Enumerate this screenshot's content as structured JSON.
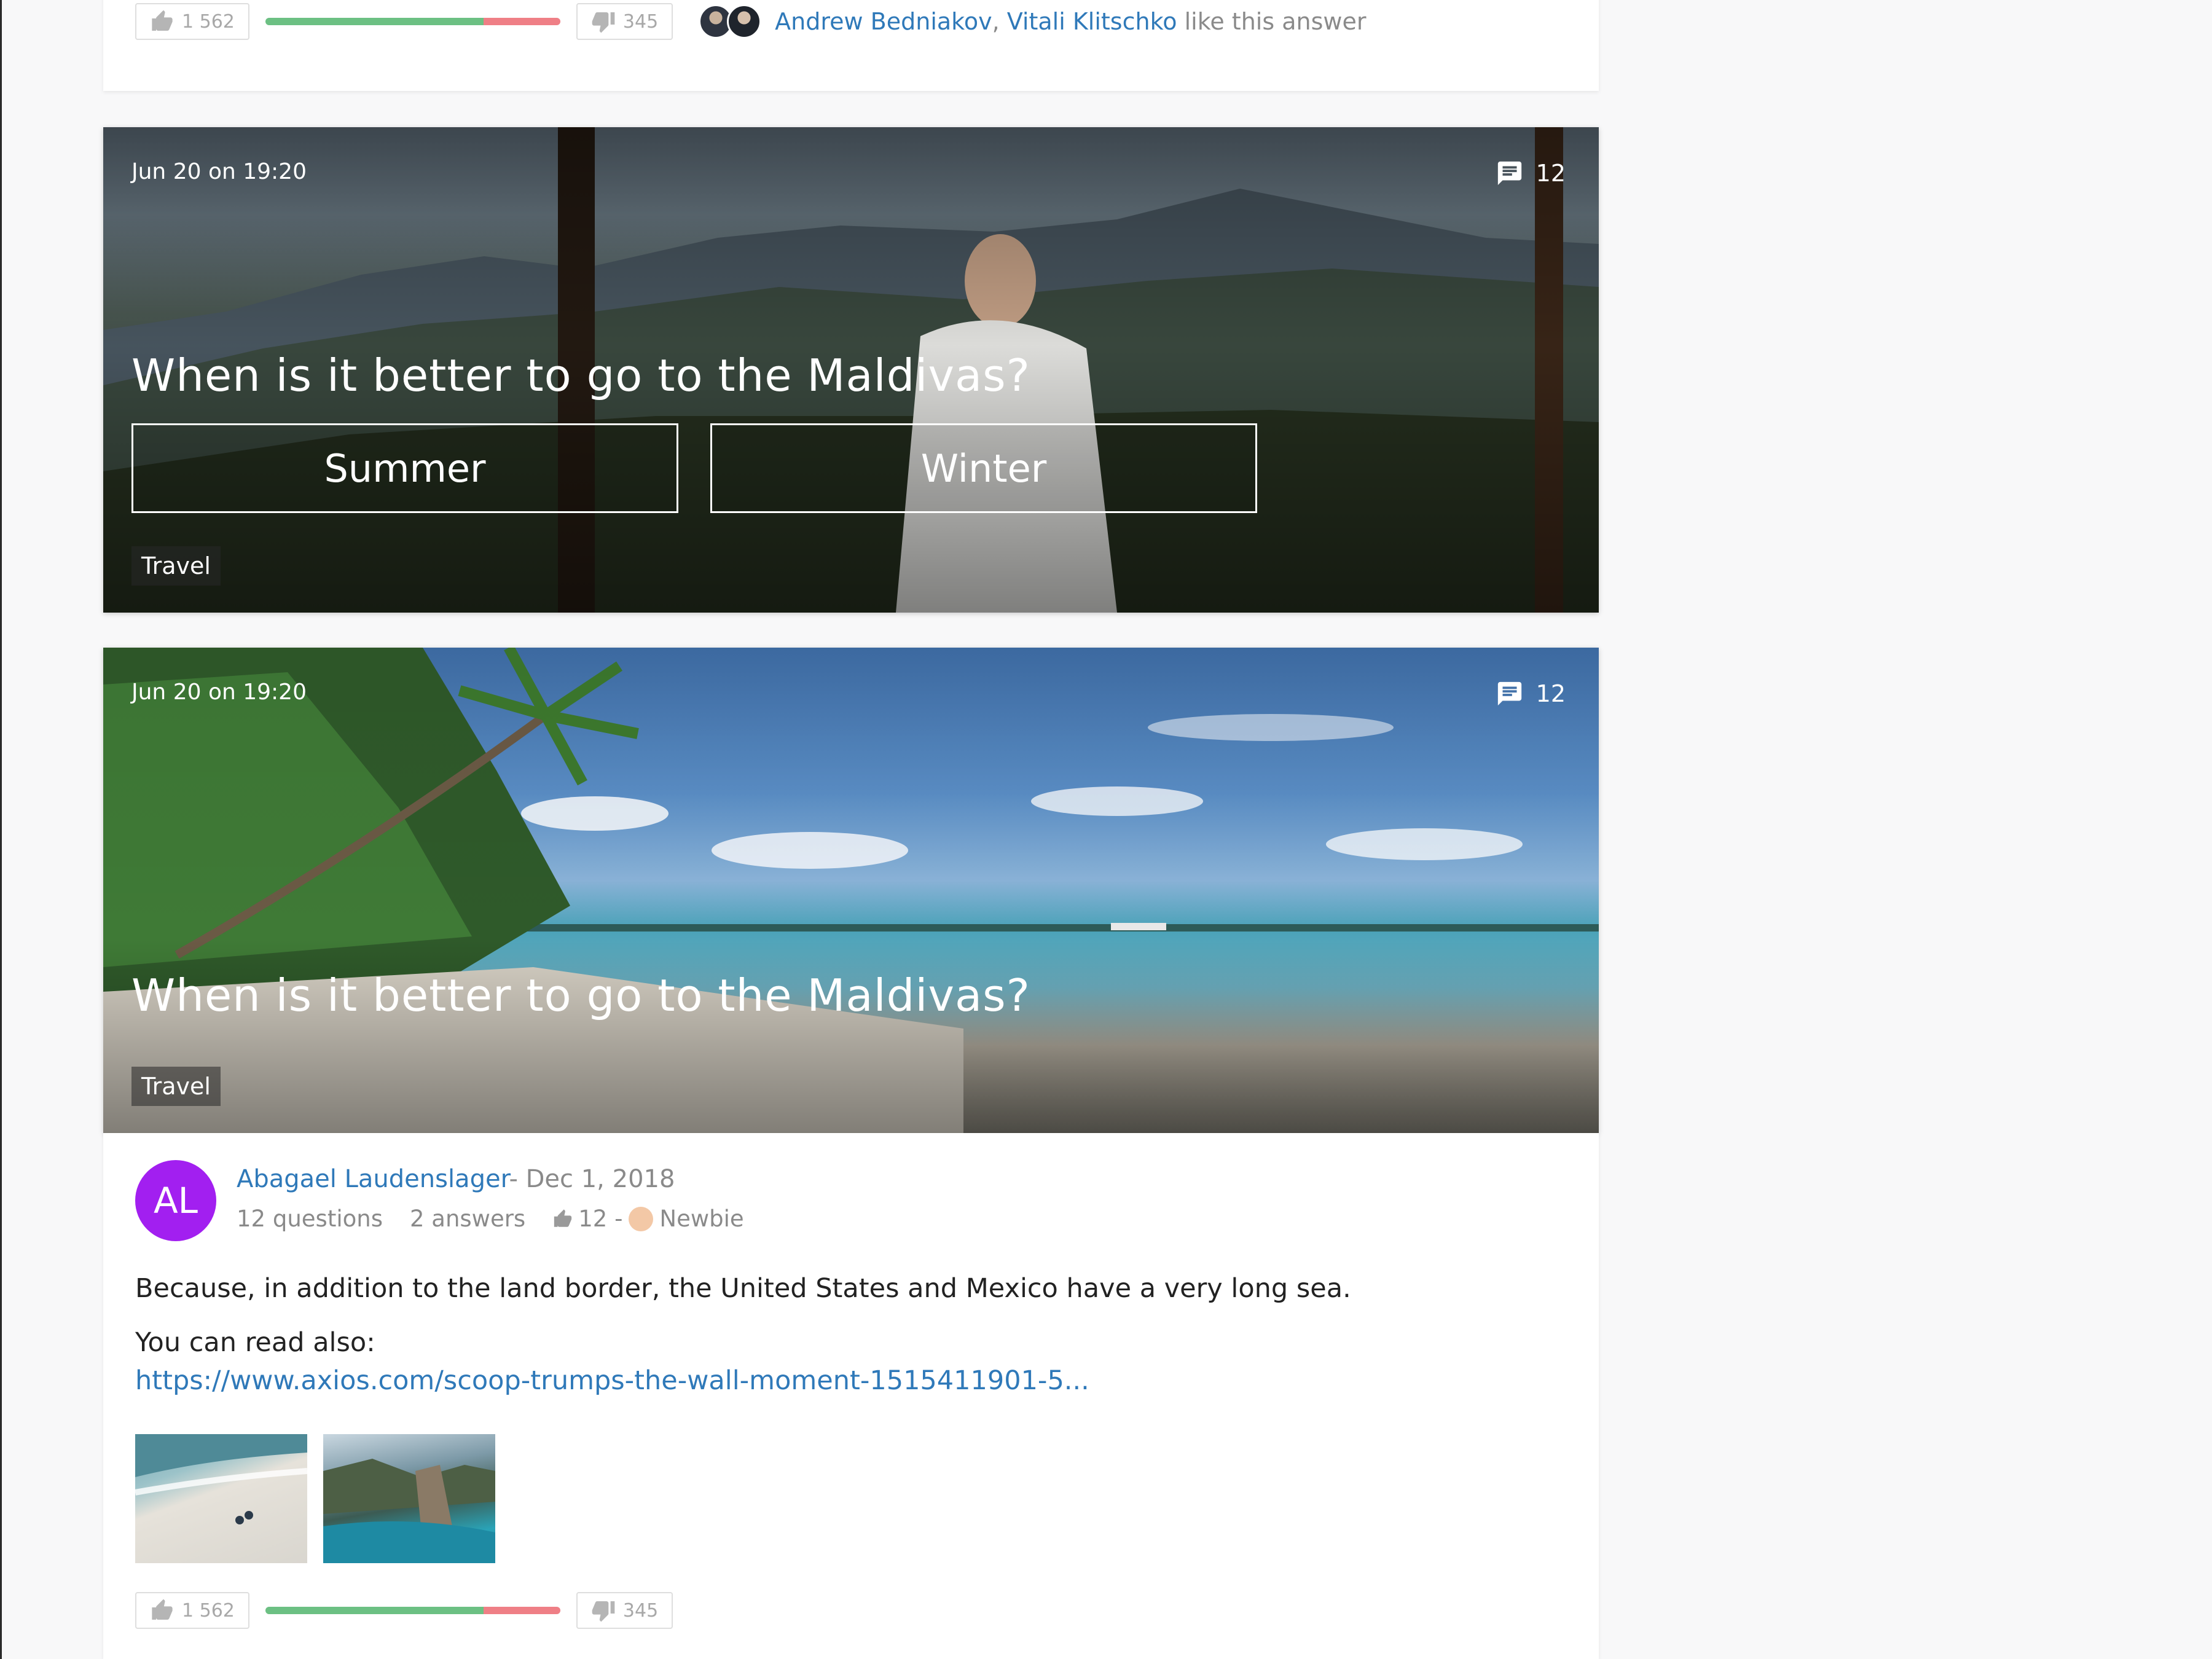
{
  "top_answer_footer": {
    "likes": "1 562",
    "dislikes": "345",
    "ratio_positive": 0.74,
    "liker_1": "Andrew Bedniakov",
    "separator": ",",
    "liker_2": "Vitali Klitschko",
    "likes_suffix": "like this answer"
  },
  "poll_card": {
    "date": "Jun 20 on 19:20",
    "comments": "12",
    "question": "When is it better to go to the Maldivas?",
    "options": [
      "Summer",
      "Winter"
    ],
    "tag": "Travel"
  },
  "question_card": {
    "date": "Jun 20 on 19:20",
    "comments": "12",
    "question": "When is it better to go to the Maldivas?",
    "tag": "Travel"
  },
  "answer": {
    "avatar_initials": "AL",
    "author": "Abagael Laudenslager",
    "date": "- Dec 1, 2018",
    "questions": "12 questions",
    "answers": "2 answers",
    "likes": "12",
    "rank_separator": "-",
    "rank": "Newbie",
    "text": "Because, in addition to the land border, the United States and Mexico have a very long sea.",
    "read_also": "You can read also:",
    "link": "https://www.axios.com/scoop-trumps-the-wall-moment-1515411901-5...",
    "votes": {
      "likes": "1 562",
      "dislikes": "345",
      "ratio_positive": 0.74
    }
  },
  "colors": {
    "link": "#2f79b9",
    "avatar": "#a21ff0",
    "bar_positive": "#6cc083",
    "bar_negative": "#ef7f86"
  },
  "icons": [
    "thumb-up-icon",
    "thumb-down-icon",
    "comment-icon",
    "newbie-badge-icon"
  ]
}
